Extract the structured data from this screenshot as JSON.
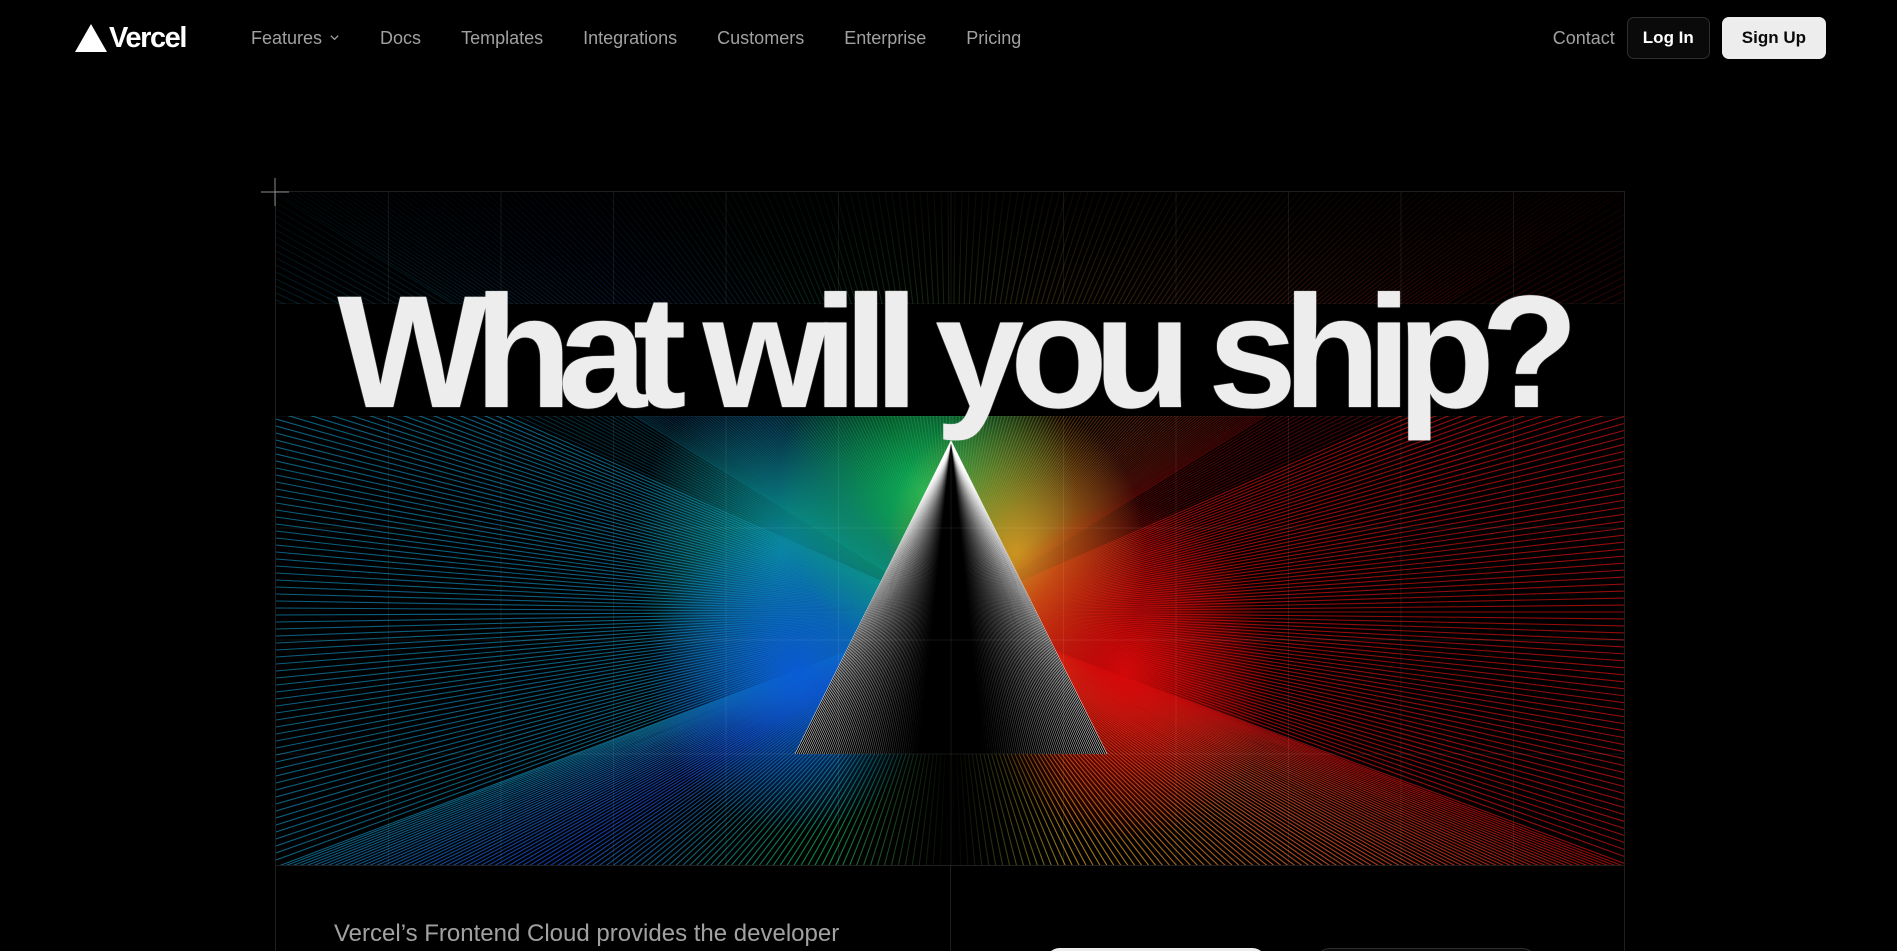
{
  "brand": {
    "name": "Vercel",
    "logo_icon": "vercel-triangle-icon"
  },
  "nav": {
    "links": [
      {
        "label": "Features",
        "has_dropdown": true
      },
      {
        "label": "Docs"
      },
      {
        "label": "Templates"
      },
      {
        "label": "Integrations"
      },
      {
        "label": "Customers"
      },
      {
        "label": "Enterprise"
      },
      {
        "label": "Pricing"
      }
    ],
    "contact_label": "Contact",
    "login_label": "Log In",
    "signup_label": "Sign Up"
  },
  "hero": {
    "headline": "What will you ship?"
  },
  "below": {
    "tagline": "Vercel’s Frontend Cloud provides the developer"
  },
  "colors": {
    "background": "#000000",
    "text_primary": "#ededed",
    "text_secondary": "#a1a1a1",
    "spectrum": [
      "#0f7fa8",
      "#1d4fd8",
      "#0fb35a",
      "#d9a21b",
      "#e8572a",
      "#c41010"
    ]
  }
}
